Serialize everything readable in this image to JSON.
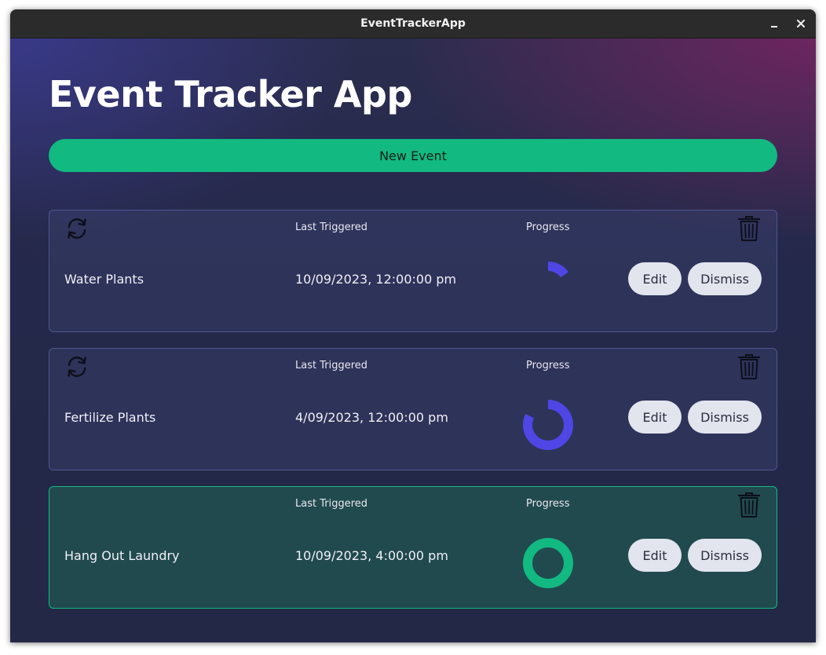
{
  "window": {
    "title": "EventTrackerApp"
  },
  "app": {
    "title": "Event Tracker App",
    "new_event_label": "New Event"
  },
  "labels": {
    "last_triggered": "Last Triggered",
    "progress": "Progress"
  },
  "buttons": {
    "edit": "Edit",
    "dismiss": "Dismiss"
  },
  "colors": {
    "accent": "#12b981",
    "progress_active": "#4f46e5",
    "progress_done": "#12b981"
  },
  "events": [
    {
      "name": "Water Plants",
      "last_triggered": "10/09/2023, 12:00:00 pm",
      "progress": 0.15,
      "repeating": true,
      "complete": false
    },
    {
      "name": "Fertilize Plants",
      "last_triggered": "4/09/2023, 12:00:00 pm",
      "progress": 0.82,
      "repeating": true,
      "complete": false
    },
    {
      "name": "Hang Out Laundry",
      "last_triggered": "10/09/2023, 4:00:00 pm",
      "progress": 1.0,
      "repeating": false,
      "complete": true
    }
  ]
}
